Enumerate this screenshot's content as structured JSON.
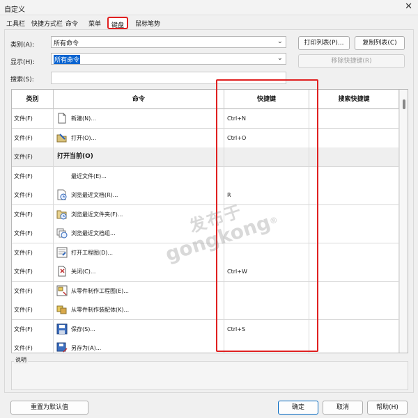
{
  "window": {
    "title": "自定义",
    "close": "✕"
  },
  "tabs": [
    {
      "label": "工具栏"
    },
    {
      "label": "快捷方式栏"
    },
    {
      "label": "命令"
    },
    {
      "label": "菜单"
    },
    {
      "label": "键盘",
      "active": true
    },
    {
      "label": "鼠标笔势"
    }
  ],
  "filters": {
    "category_label": "类别(A):",
    "category_value": "所有命令",
    "show_label": "显示(H):",
    "show_value": "所有命令",
    "search_label": "搜索(S):",
    "search_value": ""
  },
  "buttons": {
    "print_list": "打印列表(P)...",
    "copy_list": "复制列表(C)",
    "remove_shortcut": "移除快捷键(R)",
    "reset": "重置为默认值",
    "ok": "确定",
    "cancel": "取消",
    "help": "帮助(H)"
  },
  "table": {
    "headers": [
      "类别",
      "命令",
      "快捷键",
      "搜索快捷键"
    ],
    "rows": [
      {
        "category": "文件(F)",
        "command": "新建(N)...",
        "shortcut": "Ctrl+N",
        "search": "",
        "icon": "new-document-icon"
      },
      {
        "category": "文件(F)",
        "command": "打开(O)...",
        "shortcut": "Ctrl+O",
        "search": "",
        "icon": "open-folder-icon"
      },
      {
        "category": "文件(F)",
        "command": "打开当前(O)",
        "shortcut": "",
        "search": "",
        "group": true
      },
      {
        "category": "文件(F)",
        "command": "最近文件(E)...",
        "shortcut": "",
        "search": "",
        "icon": ""
      },
      {
        "category": "文件(F)",
        "command": "浏览最近文档(R)...",
        "shortcut": "R",
        "search": "",
        "icon": "recent-documents-icon"
      },
      {
        "category": "文件(F)",
        "command": "浏览最近文件夹(F)...",
        "shortcut": "",
        "search": "",
        "icon": "recent-folders-icon"
      },
      {
        "category": "文件(F)",
        "command": "浏览最近文档组...",
        "shortcut": "",
        "search": "",
        "icon": "recent-group-icon"
      },
      {
        "category": "文件(F)",
        "command": "打开工程图(D)...",
        "shortcut": "",
        "search": "",
        "icon": "open-drawing-icon"
      },
      {
        "category": "文件(F)",
        "command": "关闭(C)...",
        "shortcut": "Ctrl+W",
        "search": "",
        "icon": "close-document-icon"
      },
      {
        "category": "文件(F)",
        "command": "从零件制作工程图(E)...",
        "shortcut": "",
        "search": "",
        "icon": "make-drawing-icon"
      },
      {
        "category": "文件(F)",
        "command": "从零件制作装配体(K)...",
        "shortcut": "",
        "search": "",
        "icon": "make-assembly-icon"
      },
      {
        "category": "文件(F)",
        "command": "保存(S)...",
        "shortcut": "Ctrl+S",
        "search": "",
        "icon": "save-icon"
      },
      {
        "category": "文件(F)",
        "command": "另存为(A)...",
        "shortcut": "",
        "search": "",
        "icon": "save-as-icon"
      }
    ]
  },
  "description": {
    "label": "说明"
  },
  "watermark": {
    "line1": "发布于",
    "line2": "gongkong",
    "mark": "®"
  }
}
